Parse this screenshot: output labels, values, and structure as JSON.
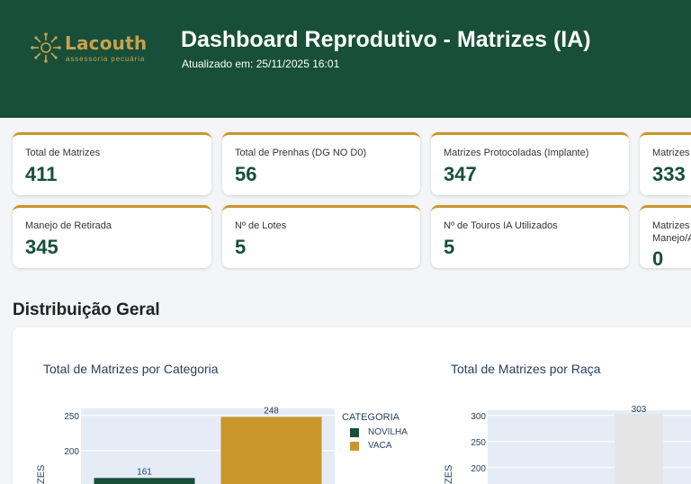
{
  "header": {
    "logo_text": "Lacouth",
    "logo_sub": "assessoria pecuária",
    "title": "Dashboard Reprodutivo - Matrizes (IA)",
    "updated": "Atualizado em: 25/11/2025 16:01",
    "bg_color": "#174f3a",
    "accent_color": "#c9962c"
  },
  "kpis_row1": [
    {
      "label": "Total de Matrizes",
      "value": "411"
    },
    {
      "label": "Total de Prenhas (DG NO D0)",
      "value": "56"
    },
    {
      "label": "Matrizes Protocoladas (Implante)",
      "value": "347"
    },
    {
      "label": "Matrizes",
      "value": "333"
    }
  ],
  "kpis_row2": [
    {
      "label": "Manejo de Retirada",
      "value": "345"
    },
    {
      "label": "Nº de Lotes",
      "value": "5"
    },
    {
      "label": "Nº de Touros IA Utilizados",
      "value": "5"
    },
    {
      "label": "Matrizes Manejo/A",
      "value": "0"
    }
  ],
  "section": {
    "title": "Distribuição Geral"
  },
  "chart_data": [
    {
      "type": "bar",
      "title": "Total de Matrizes por Categoria",
      "ylabel": "ZES",
      "categories": [
        "NOVILHA",
        "VACA"
      ],
      "values": [
        161,
        248
      ],
      "data_labels": [
        "161",
        "248"
      ],
      "colors": [
        "#174f3a",
        "#c9962c"
      ],
      "legend_title": "CATEGORIA",
      "legend": [
        "NOVILHA",
        "VACA"
      ],
      "yticks": [
        "250",
        "200"
      ],
      "ylim": [
        0,
        260
      ]
    },
    {
      "type": "bar",
      "title": "Total de Matrizes por Raça",
      "ylabel": "ZES",
      "values": [
        303
      ],
      "data_labels": [
        "303"
      ],
      "colors": [
        "#e5e5e5"
      ],
      "yticks": [
        "300",
        "250",
        "200"
      ],
      "ylim": [
        0,
        310
      ]
    }
  ]
}
